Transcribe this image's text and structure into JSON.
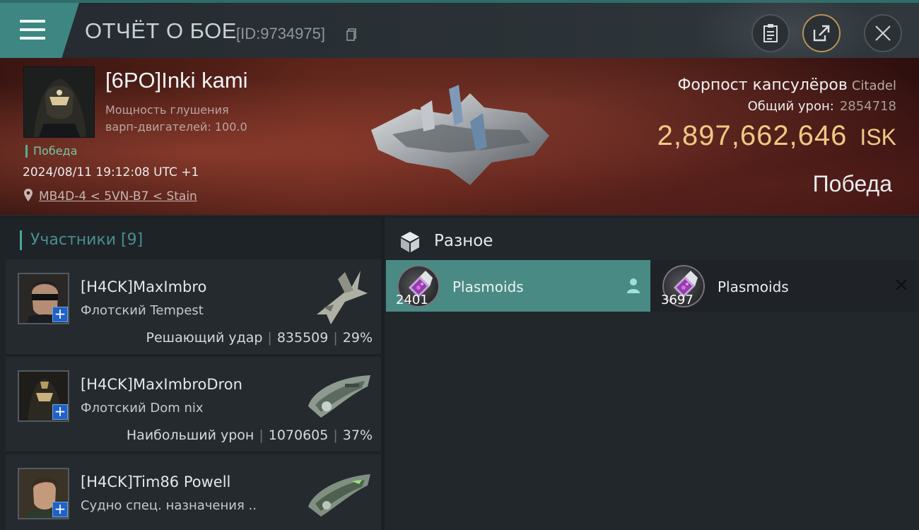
{
  "header": {
    "title": "ОТЧЁТ О БОЕ",
    "report_id": "[ID:9734975]",
    "icons": [
      "menu-icon",
      "copy-icon",
      "clipboard-icon",
      "share-icon",
      "close-icon"
    ]
  },
  "victim": {
    "pilot_name": "[6PO]Inki kami",
    "attribute_line1": "Мощность глушения",
    "attribute_line2": "варп-двигателей: 100.0",
    "result_tag": "Победа",
    "datetime": "2024/08/11 19:12:08 UTC +1",
    "location": "MB4D-4 < 5VN-B7 < Stain",
    "target_name": "Форпост капсулёров",
    "target_class": "Citadel",
    "total_damage_label": "Общий урон:",
    "total_damage_value": "2854718",
    "isk_amount": "2,897,662,646",
    "isk_currency": "ISK",
    "result": "Победа"
  },
  "participants": {
    "header": "Участники [9]",
    "items": [
      {
        "name": "[H4CK]MaxImbro",
        "ship": "Флотский Tempest",
        "role": "Решающий удар",
        "damage": "835509",
        "percent": "29%"
      },
      {
        "name": "[H4CK]MaxImbroDron",
        "ship": "Флотский Dom nix",
        "role": "Наибольший урон",
        "damage": "1070605",
        "percent": "37%"
      },
      {
        "name": "[H4CK]Tim86 Powell",
        "ship": "Судно спец. назначения ..",
        "role": "",
        "damage": "",
        "percent": ""
      }
    ]
  },
  "misc": {
    "title": "Разное",
    "items": [
      {
        "name": "Plasmoids",
        "quantity": "2401",
        "state": "dropped"
      },
      {
        "name": "Plasmoids",
        "quantity": "3697",
        "state": "destroyed"
      }
    ]
  },
  "colors": {
    "accent": "#3d8682",
    "isk_gold": "#f0c985",
    "victory_green": "#55b08c",
    "loot_dropped_bg": "#4a8a85"
  }
}
